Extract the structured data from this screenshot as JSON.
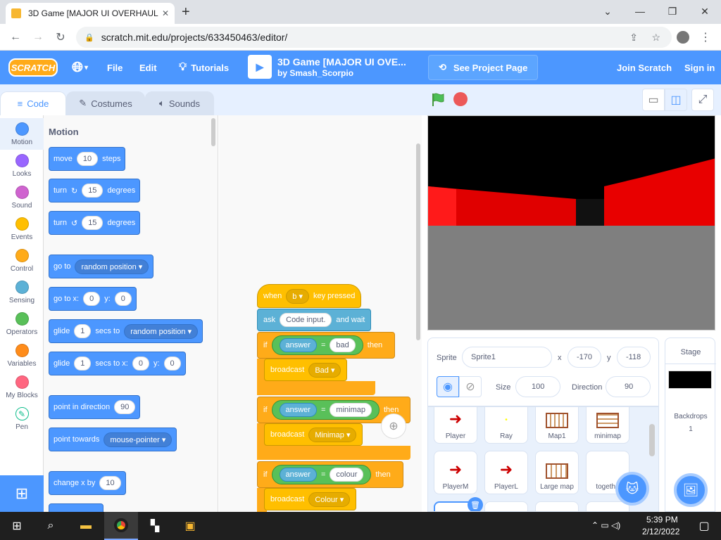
{
  "browser": {
    "tab_title": "3D Game [MAJOR UI OVERHAUL",
    "url": "scratch.mit.edu/projects/633450463/editor/"
  },
  "menubar": {
    "logo": "SCRATCH",
    "file": "File",
    "edit": "Edit",
    "tutorials": "Tutorials",
    "project_title": "3D Game [MAJOR UI OVE...",
    "project_author": "by Smash_Scorpio",
    "see_project_page": "See Project Page",
    "join": "Join Scratch",
    "sign_in": "Sign in"
  },
  "editor_tabs": [
    "Code",
    "Costumes",
    "Sounds"
  ],
  "categories": [
    {
      "label": "Motion",
      "color": "#4c97ff"
    },
    {
      "label": "Looks",
      "color": "#9966ff"
    },
    {
      "label": "Sound",
      "color": "#cf63cf"
    },
    {
      "label": "Events",
      "color": "#ffbf00"
    },
    {
      "label": "Control",
      "color": "#ffab19"
    },
    {
      "label": "Sensing",
      "color": "#5cb1d6"
    },
    {
      "label": "Operators",
      "color": "#59c059"
    },
    {
      "label": "Variables",
      "color": "#ff8c1a"
    },
    {
      "label": "My Blocks",
      "color": "#ff6680"
    },
    {
      "label": "Pen",
      "color": "#0fbd8c"
    }
  ],
  "palette": {
    "heading": "Motion",
    "move": "move",
    "move_val": "10",
    "steps": "steps",
    "turn": "turn",
    "turn_val": "15",
    "degrees": "degrees",
    "goto": "go to",
    "goto_dd": "random position",
    "gotoxy": "go to x:",
    "x0": "0",
    "y": "y:",
    "y0": "0",
    "glide": "glide",
    "glide_val": "1",
    "secs_to": "secs to",
    "glide_dd": "random position",
    "secs_to_x": "secs to x:",
    "point_dir": "point in direction",
    "dir_val": "90",
    "point_towards": "point towards",
    "towards_dd": "mouse-pointer",
    "change_x": "change x by",
    "change_x_val": "10"
  },
  "script": {
    "when": "when",
    "key": "b",
    "key_pressed": "key pressed",
    "ask": "ask",
    "ask_val": "Code input.",
    "and_wait": "and wait",
    "if": "if",
    "answer": "answer",
    "eq": "=",
    "then": "then",
    "bad": "bad",
    "broadcast": "broadcast",
    "bad_msg": "Bad",
    "minimap": "minimap",
    "minimap_msg": "Minimap",
    "colour": "colour",
    "colour_msg": "Colour"
  },
  "sprite_info": {
    "sprite_label": "Sprite",
    "sprite_name": "Sprite1",
    "x_label": "x",
    "x_val": "-170",
    "y_label": "y",
    "y_val": "-118",
    "size_label": "Size",
    "size_val": "100",
    "direction_label": "Direction",
    "direction_val": "90"
  },
  "sprites": [
    "Player",
    "Ray",
    "Map1",
    "minimap",
    "PlayerM",
    "PlayerL",
    "Large map",
    "togethe"
  ],
  "stage_pane": {
    "title": "Stage",
    "backdrops": "Backdrops",
    "count": "1"
  },
  "taskbar": {
    "time": "5:39 PM",
    "date": "2/12/2022"
  }
}
